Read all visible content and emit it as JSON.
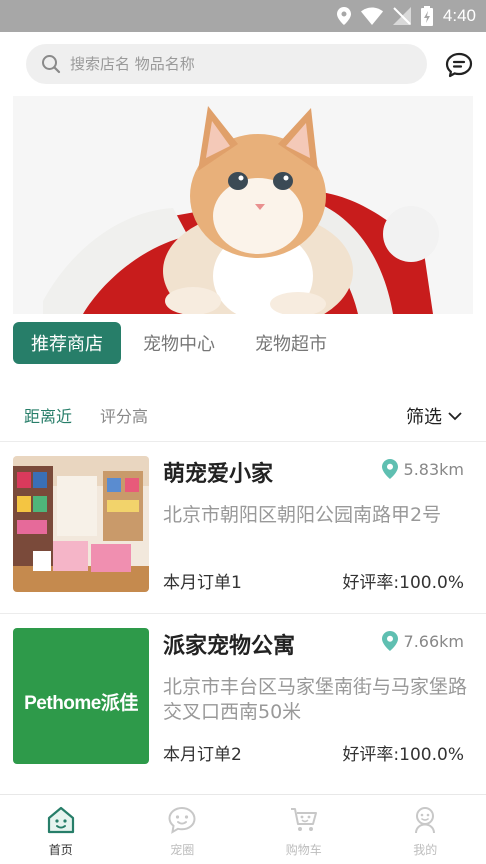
{
  "status_bar": {
    "time": "4:40"
  },
  "search": {
    "placeholder": "搜索店名 物品名称"
  },
  "banner": {
    "slide_count": 2,
    "active_slide": 1
  },
  "category_tabs": [
    {
      "label": "推荐商店",
      "active": true
    },
    {
      "label": "宠物中心",
      "active": false
    },
    {
      "label": "宠物超市",
      "active": false
    }
  ],
  "sort": {
    "options": [
      {
        "label": "距离近",
        "active": true
      },
      {
        "label": "评分高",
        "active": false
      }
    ],
    "filter_label": "筛选"
  },
  "shops": [
    {
      "name": "萌宠爱小家",
      "distance": "5.83km",
      "address": "北京市朝阳区朝阳公园南路甲2号",
      "orders": "本月订单1",
      "rating": "好评率:100.0%"
    },
    {
      "name": "派家宠物公寓",
      "distance": "7.66km",
      "address": "北京市丰台区马家堡南街与马家堡路交叉口西南50米",
      "orders": "本月订单2",
      "rating": "好评率:100.0%",
      "logo_text": "Pethome派佳"
    }
  ],
  "bottom_nav": [
    {
      "label": "首页",
      "icon": "home-icon",
      "active": true
    },
    {
      "label": "宠圈",
      "icon": "chat-bubble-icon",
      "active": false
    },
    {
      "label": "购物车",
      "icon": "cart-icon",
      "active": false
    },
    {
      "label": "我的",
      "icon": "profile-icon",
      "active": false
    }
  ],
  "colors": {
    "accent": "#277e69",
    "pin": "#5fbfb1",
    "status_bar": "#a7a7a7"
  }
}
